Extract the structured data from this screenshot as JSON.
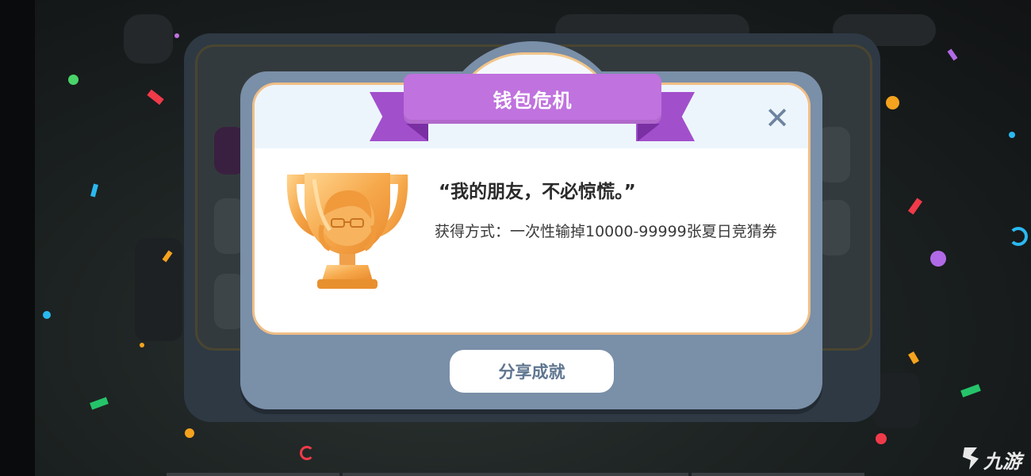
{
  "dialog": {
    "title": "钱包危机",
    "quote": "“我的朋友，不必惊慌。”",
    "method": "获得方式：一次性输掉10000-99999张夏日竞猜券",
    "close_icon": "close-icon",
    "share_label": "分享成就"
  },
  "watermark": {
    "text": "九游"
  },
  "colors": {
    "ribbon": "#c072de",
    "dialog_frame": "#7a8fa8",
    "card_border": "#f0be86",
    "share_text": "#5f7690"
  }
}
